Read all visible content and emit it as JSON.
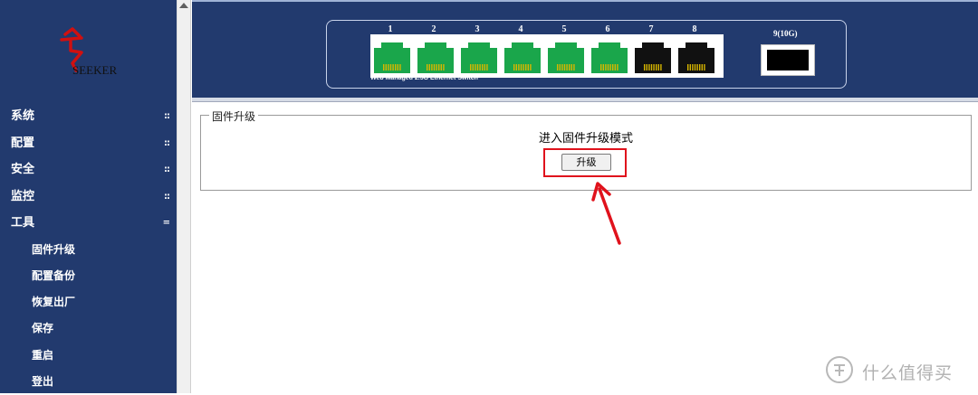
{
  "logo": {
    "text": "SEEKER"
  },
  "sidebar": {
    "items": [
      {
        "label": "系统",
        "marker": "::"
      },
      {
        "label": "配置",
        "marker": "::"
      },
      {
        "label": "安全",
        "marker": "::"
      },
      {
        "label": "监控",
        "marker": "::"
      },
      {
        "label": "工具",
        "marker": "="
      }
    ],
    "subitems": [
      {
        "label": "固件升级"
      },
      {
        "label": "配置备份"
      },
      {
        "label": "恢复出厂"
      },
      {
        "label": "保存"
      },
      {
        "label": "重启"
      },
      {
        "label": "登出"
      }
    ]
  },
  "switch": {
    "ports": [
      "1",
      "2",
      "3",
      "4",
      "5",
      "6",
      "7",
      "8"
    ],
    "port_states": [
      "green",
      "green",
      "green",
      "green",
      "green",
      "green",
      "black",
      "black"
    ],
    "label": "Web Managed 2.5G Ethernet Switch",
    "sfp_label": "9(10G)"
  },
  "main": {
    "legend": "固件升级",
    "heading": "进入固件升级模式",
    "button_label": "升级"
  },
  "watermark": {
    "text": "什么值得买"
  },
  "colors": {
    "sidebar_bg": "#223a6e",
    "port_green": "#1aa64b",
    "highlight_red": "#e0121c"
  }
}
